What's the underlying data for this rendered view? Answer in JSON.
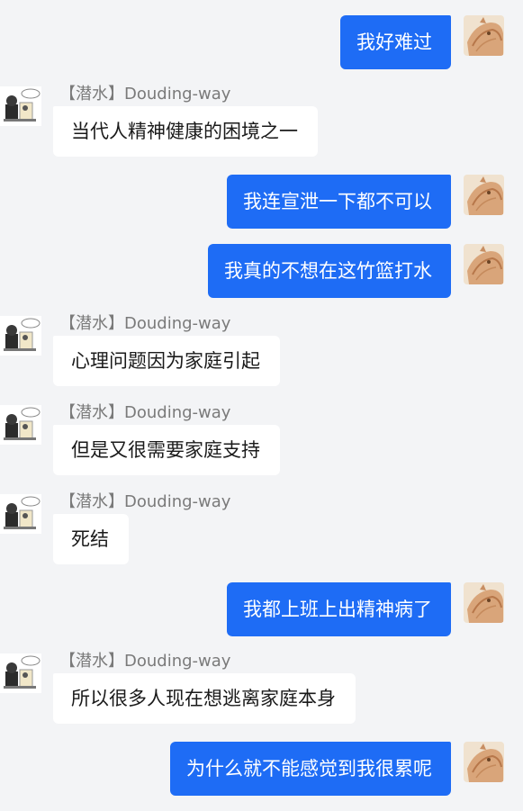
{
  "messages": [
    {
      "dir": "out",
      "text": "我好难过"
    },
    {
      "dir": "in",
      "sender": "【潜水】Douding-way",
      "text": "当代人精神健康的困境之一"
    },
    {
      "dir": "out",
      "text": "我连宣泄一下都不可以"
    },
    {
      "dir": "out",
      "text": "我真的不想在这竹篮打水"
    },
    {
      "dir": "in",
      "sender": "【潜水】Douding-way",
      "text": "心理问题因为家庭引起"
    },
    {
      "dir": "in",
      "sender": "【潜水】Douding-way",
      "text": "但是又很需要家庭支持"
    },
    {
      "dir": "in",
      "sender": "【潜水】Douding-way",
      "text": "死结"
    },
    {
      "dir": "out",
      "text": "我都上班上出精神病了"
    },
    {
      "dir": "in",
      "sender": "【潜水】Douding-way",
      "text": "所以很多人现在想逃离家庭本身"
    },
    {
      "dir": "out",
      "text": "为什么就不能感觉到我很累呢"
    }
  ],
  "colors": {
    "background": "#f3f4f6",
    "outgoing_bubble": "#1e6cf5",
    "incoming_bubble": "#ffffff",
    "sender_text": "#7a7a7a"
  },
  "icons": {
    "self_avatar": "cat-avatar-icon",
    "other_avatar": "cartoon-avatar-icon"
  }
}
